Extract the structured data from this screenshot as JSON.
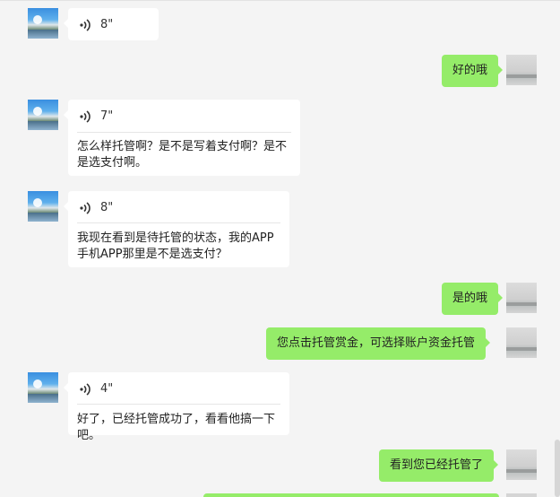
{
  "messages": [
    {
      "side": "in",
      "type": "voice",
      "duration": "8\""
    },
    {
      "side": "out",
      "type": "text",
      "text": "好的哦"
    },
    {
      "side": "in",
      "type": "voice",
      "duration": "7\"",
      "transcript": "怎么样托管啊？是不是写着支付啊？是不是选支付啊。"
    },
    {
      "side": "in",
      "type": "voice",
      "duration": "8\"",
      "transcript": "我现在看到是待托管的状态，我的APP手机APP那里是不是选支付？"
    },
    {
      "side": "out",
      "type": "text",
      "text": "是的哦"
    },
    {
      "side": "out",
      "type": "text",
      "text": "您点击托管赏金，可选择账户资金托管"
    },
    {
      "side": "in",
      "type": "voice",
      "duration": "4\"",
      "transcript": "好了，已经托管成功了，看看他搞一下吧。"
    },
    {
      "side": "out",
      "type": "text",
      "text": "看到您已经托管了"
    }
  ],
  "icons": {
    "voice": "voice-wave-icon",
    "avatar_left": "avatar-landscape",
    "avatar_right": "avatar-seashore"
  },
  "colors": {
    "out_bubble": "#95ec69",
    "in_bubble": "#ffffff",
    "background": "#f4f4f4"
  }
}
